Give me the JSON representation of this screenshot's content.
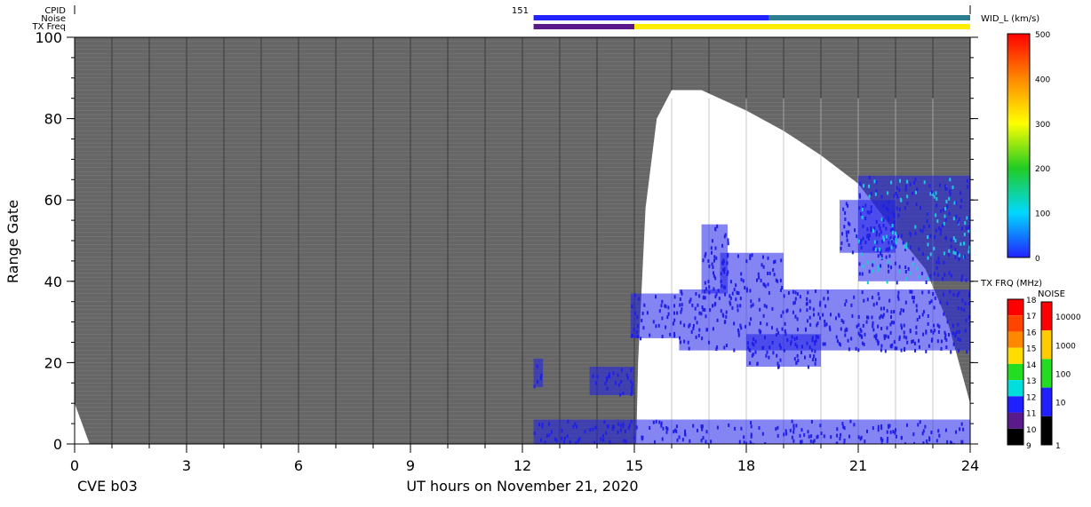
{
  "header_labels": {
    "cpid": "CPID",
    "noise": "Noise",
    "txfreq": "TX Freq",
    "cpid_value": "151"
  },
  "chart_data": {
    "type": "heatmap",
    "xlabel": "UT hours on November 21, 2020",
    "ylabel": "Range Gate",
    "station_label": "CVE b03",
    "xlim": [
      0,
      24
    ],
    "ylim": [
      0,
      100
    ],
    "xticks": [
      "0",
      "3",
      "6",
      "9",
      "12",
      "15",
      "18",
      "21",
      "24"
    ],
    "yticks": [
      "0",
      "20",
      "40",
      "60",
      "80",
      "100"
    ],
    "background_color": "#666666",
    "scatter_color": "#ffffff",
    "echo_color": "#1f1fe8",
    "ground_scatter_bottom": [
      [
        0,
        10
      ],
      [
        0.4,
        0
      ]
    ],
    "ground_scatter_region": [
      [
        15.05,
        0
      ],
      [
        15.1,
        20
      ],
      [
        15.3,
        58
      ],
      [
        15.6,
        80
      ],
      [
        16.0,
        87
      ],
      [
        16.8,
        87
      ],
      [
        18.0,
        82
      ],
      [
        19.0,
        77
      ],
      [
        20.0,
        71
      ],
      [
        21.0,
        64
      ],
      [
        22.0,
        52
      ],
      [
        22.8,
        43
      ],
      [
        23.4,
        30
      ],
      [
        24.0,
        10
      ],
      [
        24.0,
        0
      ]
    ],
    "echo_regions": [
      {
        "x": [
          12.3,
          12.55
        ],
        "y": [
          14,
          21
        ]
      },
      {
        "x": [
          13.8,
          15.0
        ],
        "y": [
          12,
          19
        ]
      },
      {
        "x": [
          14.9,
          16.2
        ],
        "y": [
          26,
          37
        ]
      },
      {
        "x": [
          16.2,
          24.0
        ],
        "y": [
          23,
          38
        ]
      },
      {
        "x": [
          18.0,
          20.0
        ],
        "y": [
          19,
          27
        ]
      },
      {
        "x": [
          17.3,
          19.0
        ],
        "y": [
          38,
          47
        ]
      },
      {
        "x": [
          16.8,
          17.5
        ],
        "y": [
          37,
          54
        ]
      },
      {
        "x": [
          12.3,
          24.0
        ],
        "y": [
          0,
          6
        ]
      },
      {
        "x": [
          20.5,
          22.0
        ],
        "y": [
          47,
          60
        ]
      },
      {
        "x": [
          21.0,
          24.0
        ],
        "y": [
          40,
          66
        ]
      }
    ],
    "colorbars": [
      {
        "title": "WID_L (km/s)",
        "ticks": [
          "0",
          "100",
          "200",
          "300",
          "400",
          "500"
        ],
        "colors": [
          "#2222ff",
          "#00d8ff",
          "#22cc22",
          "#ffff00",
          "#ff8800",
          "#ff0000"
        ]
      },
      {
        "title": "TX FRQ (MHz)",
        "ticks": [
          "18",
          "17",
          "16",
          "15",
          "14",
          "13",
          "12",
          "11",
          "10",
          "9"
        ],
        "colors": [
          "#ff0000",
          "#ff4400",
          "#ff8800",
          "#ffdd00",
          "#22dd22",
          "#00dddd",
          "#1f1fff",
          "#5a1a8c",
          "#000000"
        ]
      },
      {
        "title": "NOISE",
        "ticks": [
          "10000",
          "1000",
          "100",
          "10",
          "1"
        ],
        "colors": [
          "#ff0000",
          "#ffcc00",
          "#22dd22",
          "#1f1fff",
          "#000000"
        ]
      }
    ],
    "status_bars": {
      "noise": {
        "x": [
          12.3,
          24.0
        ],
        "color": "#2222ff",
        "green_from": 18.6
      },
      "txfreq": [
        {
          "x": [
            12.3,
            15.0
          ],
          "color": "#5a1a8c"
        },
        {
          "x": [
            15.0,
            24.0
          ],
          "color": "#ffee00"
        }
      ]
    }
  }
}
